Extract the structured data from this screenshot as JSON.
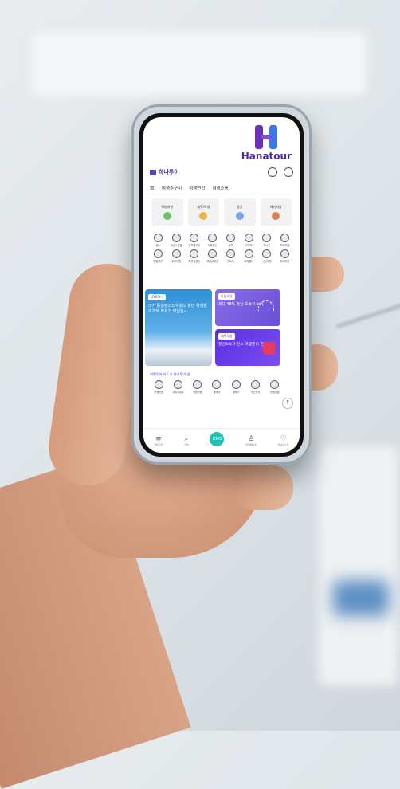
{
  "brand": {
    "logo_text": "Hanatour"
  },
  "app": {
    "logo_text": "하나투어",
    "header_icons": [
      "global-icon",
      "recent-icon"
    ],
    "tabs": [
      {
        "label": "≡"
      },
      {
        "label": "여행추구미"
      },
      {
        "label": "여행연합"
      },
      {
        "label": "여행소풍"
      }
    ],
    "category_cards": [
      {
        "label": "해외여행",
        "icon": "globe-icon",
        "color": "#6cc36a"
      },
      {
        "label": "제주/국내",
        "icon": "island-icon",
        "color": "#e6b54a"
      },
      {
        "label": "항공",
        "icon": "plane-icon",
        "color": "#7aa6e8"
      },
      {
        "label": "패키지일",
        "icon": "hotel-icon",
        "color": "#d9824a"
      }
    ],
    "service_icons": [
      {
        "label": "패스"
      },
      {
        "label": "항공+호텔"
      },
      {
        "label": "단독패키지"
      },
      {
        "label": "자유할인"
      },
      {
        "label": "골프"
      },
      {
        "label": "크루즈"
      },
      {
        "label": "허니문"
      },
      {
        "label": "프리미엄"
      },
      {
        "label": "당일렌즈"
      },
      {
        "label": "우리여행"
      },
      {
        "label": "투어입장권"
      },
      {
        "label": "해외입장권"
      },
      {
        "label": "렌트카"
      },
      {
        "label": "로밍통신"
      },
      {
        "label": "신상여행"
      },
      {
        "label": "우리여권"
      }
    ],
    "banners": {
      "live": {
        "tag": "LIVE특가",
        "text": "스키 동일렌스노우월드 항만 하이원 리조트 최저가 타임딜~"
      },
      "top": {
        "tag": "타임세일",
        "text": "최대 48% 할인 초특가 보기"
      },
      "bottom": {
        "tag": "혜택모음",
        "text": "할인&특가 찬스 여행준비 한번에!"
      }
    },
    "section_title": "여행투어 지도기 하나투어 앱",
    "bottom_icons": [
      {
        "label": "여행연합"
      },
      {
        "label": "여행가계부"
      },
      {
        "label": "여행보험"
      },
      {
        "label": "클래식"
      },
      {
        "label": "클래스"
      },
      {
        "label": "여권관리"
      },
      {
        "label": "여행서랍"
      }
    ],
    "nav": [
      {
        "label": "카테고리",
        "icon": "menu-icon"
      },
      {
        "label": "검색",
        "icon": "search-icon"
      },
      {
        "label": "DMS",
        "icon": "home-icon"
      },
      {
        "label": "마이페이지",
        "icon": "user-icon"
      },
      {
        "label": "위시리스트",
        "icon": "heart-icon"
      }
    ]
  }
}
